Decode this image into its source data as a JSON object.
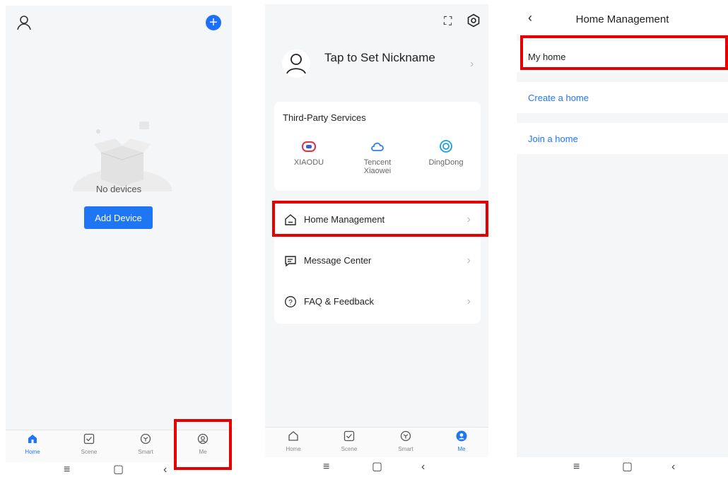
{
  "colors": {
    "accent": "#1f76f5",
    "highlight": "#e60000"
  },
  "screen1": {
    "empty_text": "No devices",
    "add_device_label": "Add Device",
    "icons": {
      "top_left": "user-icon",
      "top_right": "add-circle-icon"
    },
    "tabs": [
      {
        "label": "Home",
        "icon": "home-icon",
        "active": true
      },
      {
        "label": "Scene",
        "icon": "scene-check-icon",
        "active": false
      },
      {
        "label": "Smart",
        "icon": "smart-cube-icon",
        "active": false
      },
      {
        "label": "Me",
        "icon": "me-user-icon",
        "active": false
      }
    ],
    "system_nav": [
      "menu-icon",
      "home-square-icon",
      "back-icon"
    ]
  },
  "screen2": {
    "nickname": "Tap to Set Nickname",
    "third_party_title": "Third-Party Services",
    "services": [
      {
        "label": "XIAODU",
        "icon": "xiaodu-icon"
      },
      {
        "label": "Tencent Xiaowei",
        "icon": "tencent-cloud-icon"
      },
      {
        "label": "DingDong",
        "icon": "dingdong-icon"
      }
    ],
    "menu": [
      {
        "label": "Home Management",
        "icon": "house-icon"
      },
      {
        "label": "Message Center",
        "icon": "message-icon"
      },
      {
        "label": "FAQ & Feedback",
        "icon": "help-icon"
      }
    ],
    "tabs": [
      {
        "label": "Home",
        "active": false
      },
      {
        "label": "Scene",
        "active": false
      },
      {
        "label": "Smart",
        "active": false
      },
      {
        "label": "Me",
        "active": true
      }
    ]
  },
  "screen3": {
    "title": "Home Management",
    "rows": [
      {
        "label": "My home"
      },
      {
        "label": "Create a home"
      },
      {
        "label": "Join a home"
      }
    ]
  }
}
